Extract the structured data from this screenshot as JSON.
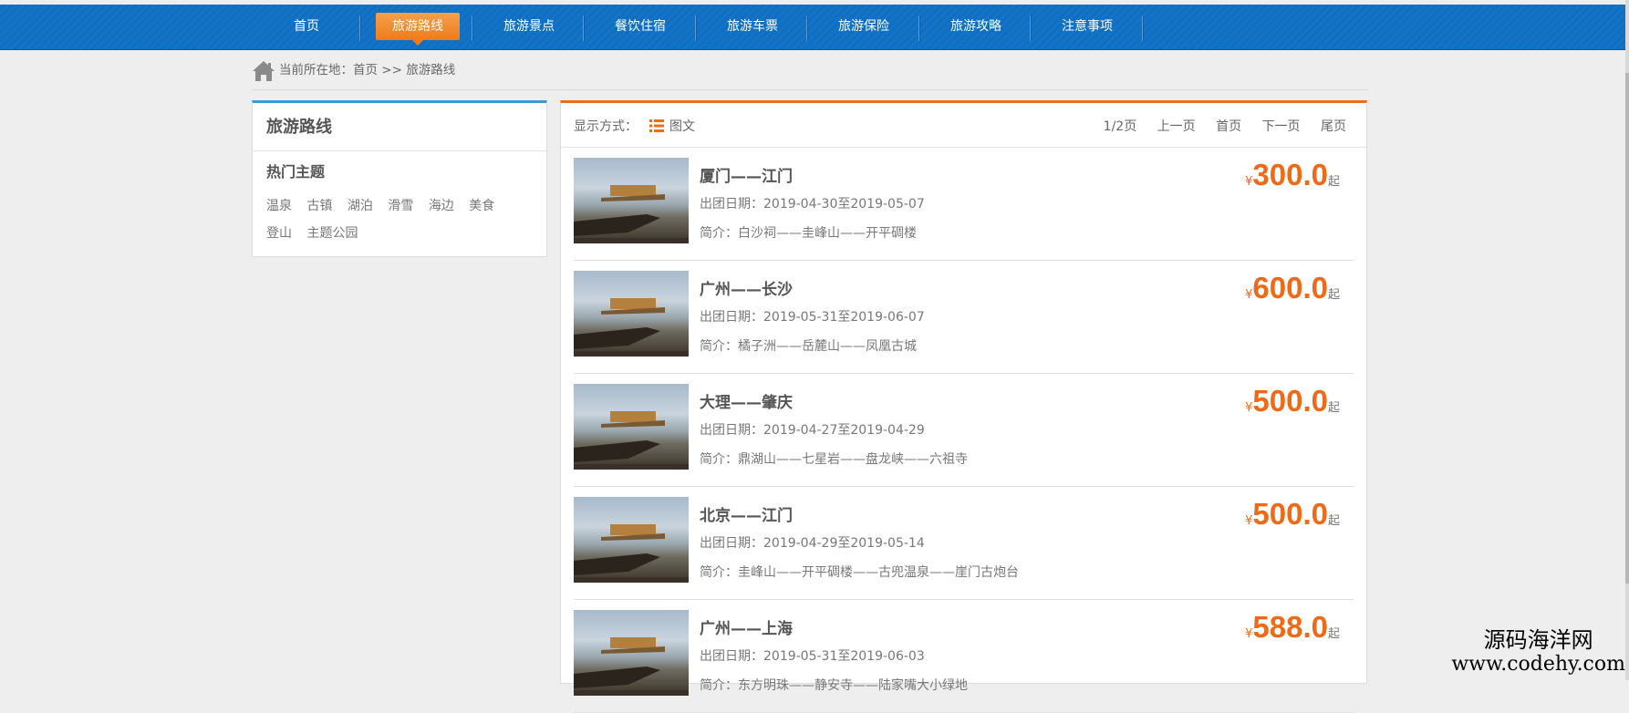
{
  "nav": {
    "items": [
      "首页",
      "旅游路线",
      "旅游景点",
      "餐饮住宿",
      "旅游车票",
      "旅游保险",
      "旅游攻略",
      "注意事项"
    ],
    "active_index": 1
  },
  "breadcrumb": {
    "text": "当前所在地：首页 >> 旅游路线"
  },
  "sidebar": {
    "title": "旅游路线",
    "subtitle": "热门主题",
    "tags": [
      "温泉",
      "古镇",
      "湖泊",
      "滑雪",
      "海边",
      "美食",
      "登山",
      "主题公园"
    ]
  },
  "toolbar": {
    "label": "显示方式：",
    "mode": "图文",
    "pager": [
      "1/2页",
      "上一页",
      "首页",
      "下一页",
      "尾页"
    ]
  },
  "routes": [
    {
      "title": "厦门——江门",
      "date": "出团日期：2019-04-30至2019-05-07",
      "desc": "简介：白沙祠——圭峰山——开平碉楼",
      "price": "300.0"
    },
    {
      "title": "广州——长沙",
      "date": "出团日期：2019-05-31至2019-06-07",
      "desc": "简介：橘子洲——岳麓山——凤凰古城",
      "price": "600.0"
    },
    {
      "title": "大理——肇庆",
      "date": "出团日期：2019-04-27至2019-04-29",
      "desc": "简介：鼎湖山——七星岩——盘龙峡——六祖寺",
      "price": "500.0"
    },
    {
      "title": "北京——江门",
      "date": "出团日期：2019-04-29至2019-05-14",
      "desc": "简介：圭峰山——开平碉楼——古兜温泉——崖门古炮台",
      "price": "500.0"
    },
    {
      "title": "广州——上海",
      "date": "出团日期：2019-05-31至2019-06-03",
      "desc": "简介：东方明珠——静安寺——陆家嘴大小绿地",
      "price": "588.0"
    }
  ],
  "price_prefix": "¥",
  "price_suffix": "起",
  "watermark": {
    "line1": "源码海洋网",
    "line2": "www.codehy.com"
  },
  "colors": {
    "nav_blue": "#0f6fc3",
    "accent_orange": "#ef6c1a",
    "sidebar_blue": "#3a9ad9"
  }
}
